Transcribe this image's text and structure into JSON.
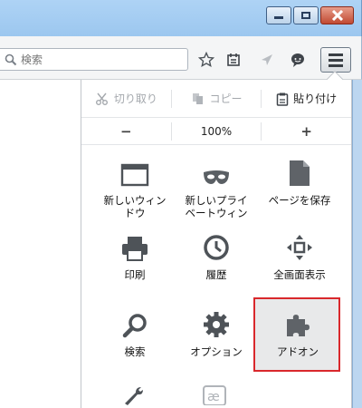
{
  "toolbar": {
    "search_placeholder": "検索"
  },
  "edit_row": {
    "cut": "切り取り",
    "copy": "コピー",
    "paste": "貼り付け"
  },
  "zoom_row": {
    "minus": "−",
    "level": "100%",
    "plus": "+"
  },
  "items": {
    "new_window": "新しいウィン\nドウ",
    "private_window": "新しいプライ\nベートウィン",
    "save_page": "ページを保存",
    "print": "印刷",
    "history": "履歴",
    "fullscreen": "全画面表示",
    "search": "検索",
    "options": "オプション",
    "addons": "アドオン"
  },
  "colors": {
    "highlight_border": "#d9282c",
    "icon_gray": "#5f6368"
  }
}
